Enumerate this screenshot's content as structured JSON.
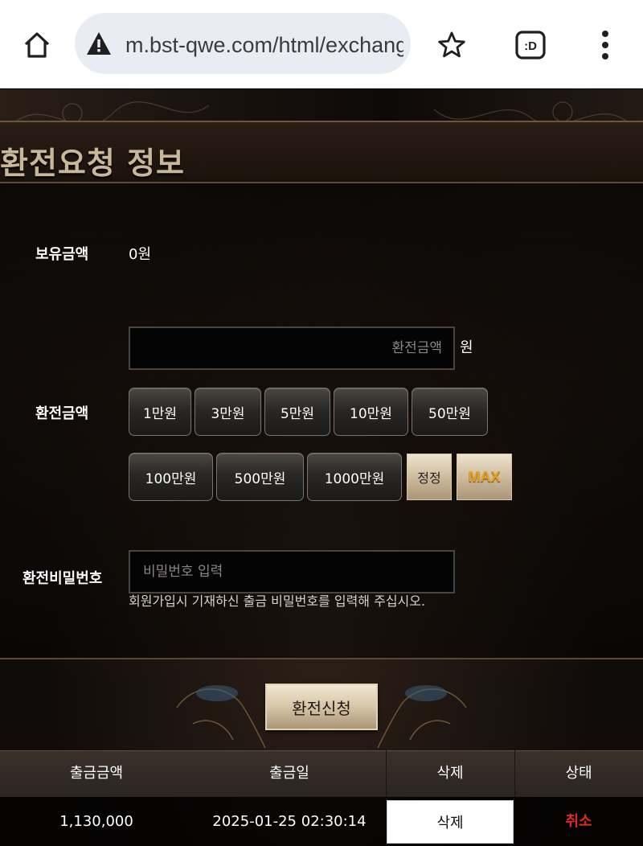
{
  "browser": {
    "url": "m.bst-qwe.com/html/exchang"
  },
  "page": {
    "title": "환전요청 정보"
  },
  "form": {
    "balance_label": "보유금액",
    "balance_value": "0원",
    "amount_label": "환전금액",
    "amount_placeholder": "환전금액",
    "amount_unit": "원",
    "amount_buttons_row1": [
      "1만원",
      "3만원",
      "5만원",
      "10만원",
      "50만원"
    ],
    "amount_buttons_row2": [
      "100만원",
      "500만원",
      "1000만원"
    ],
    "reset_label": "정정",
    "max_label": "MAX",
    "password_label": "환전비밀번호",
    "password_placeholder": "비밀번호 입력",
    "password_hint": "회원가입시 기재하신 출금 비밀번호를 입력해 주십시오.",
    "submit_label": "환전신청"
  },
  "table": {
    "headers": [
      "출금금액",
      "출금일",
      "삭제",
      "상태"
    ],
    "rows": [
      {
        "amount": "1,130,000",
        "date": "2025-01-25 02:30:14",
        "delete_label": "삭제",
        "status": "취소"
      }
    ]
  },
  "colors": {
    "accent_gold": "#c9b79a",
    "status_cancel": "#e12a1f",
    "max_text": "#e5a021"
  }
}
